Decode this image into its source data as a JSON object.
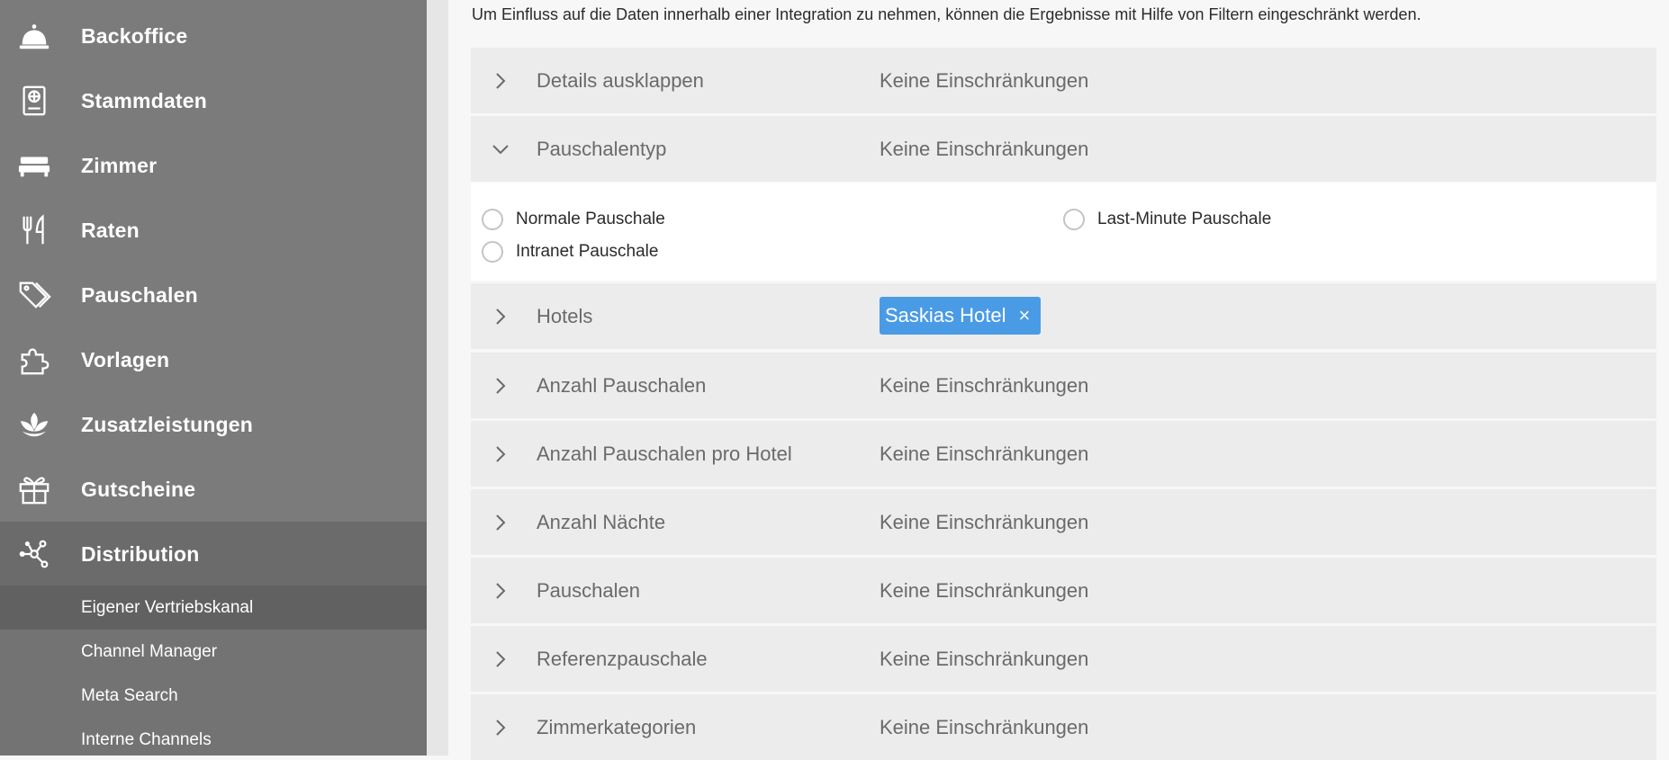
{
  "sidebar": {
    "items": [
      {
        "label": "Backoffice",
        "icon": "bell-icon"
      },
      {
        "label": "Stammdaten",
        "icon": "id-card-icon"
      },
      {
        "label": "Zimmer",
        "icon": "bed-icon"
      },
      {
        "label": "Raten",
        "icon": "utensils-icon"
      },
      {
        "label": "Pauschalen",
        "icon": "tags-icon"
      },
      {
        "label": "Vorlagen",
        "icon": "puzzle-icon"
      },
      {
        "label": "Zusatzleistungen",
        "icon": "lotus-icon"
      },
      {
        "label": "Gutscheine",
        "icon": "gift-icon"
      },
      {
        "label": "Distribution",
        "icon": "network-icon"
      }
    ],
    "subitems": [
      {
        "label": "Eigener Vertriebskanal"
      },
      {
        "label": "Channel Manager"
      },
      {
        "label": "Meta Search"
      },
      {
        "label": "Interne Channels"
      }
    ]
  },
  "main": {
    "intro": "Um Einfluss auf die Daten innerhalb einer Integration zu nehmen, können die Ergebnisse mit Hilfe von Filtern eingeschränkt werden.",
    "filters": [
      {
        "label": "Details ausklappen",
        "value": "Keine Einschränkungen"
      },
      {
        "label": "Pauschalentyp",
        "value": "Keine Einschränkungen"
      },
      {
        "label": "Hotels",
        "tag": "Saskias Hotel",
        "tag_remove": "×"
      },
      {
        "label": "Anzahl Pauschalen",
        "value": "Keine Einschränkungen"
      },
      {
        "label": "Anzahl Pauschalen pro Hotel",
        "value": "Keine Einschränkungen"
      },
      {
        "label": "Anzahl Nächte",
        "value": "Keine Einschränkungen"
      },
      {
        "label": "Pauschalen",
        "value": "Keine Einschränkungen"
      },
      {
        "label": "Referenzpauschale",
        "value": "Keine Einschränkungen"
      },
      {
        "label": "Zimmerkategorien",
        "value": "Keine Einschränkungen"
      }
    ],
    "pauschalentyp_options": [
      {
        "label": "Normale Pauschale"
      },
      {
        "label": "Last-Minute Pauschale"
      },
      {
        "label": "Intranet Pauschale"
      }
    ]
  },
  "colors": {
    "sidebar_bg": "#7b7b7b",
    "sidebar_active": "#6b6b6b",
    "tag_bg": "#4a9be6",
    "row_bg": "#ececec"
  }
}
